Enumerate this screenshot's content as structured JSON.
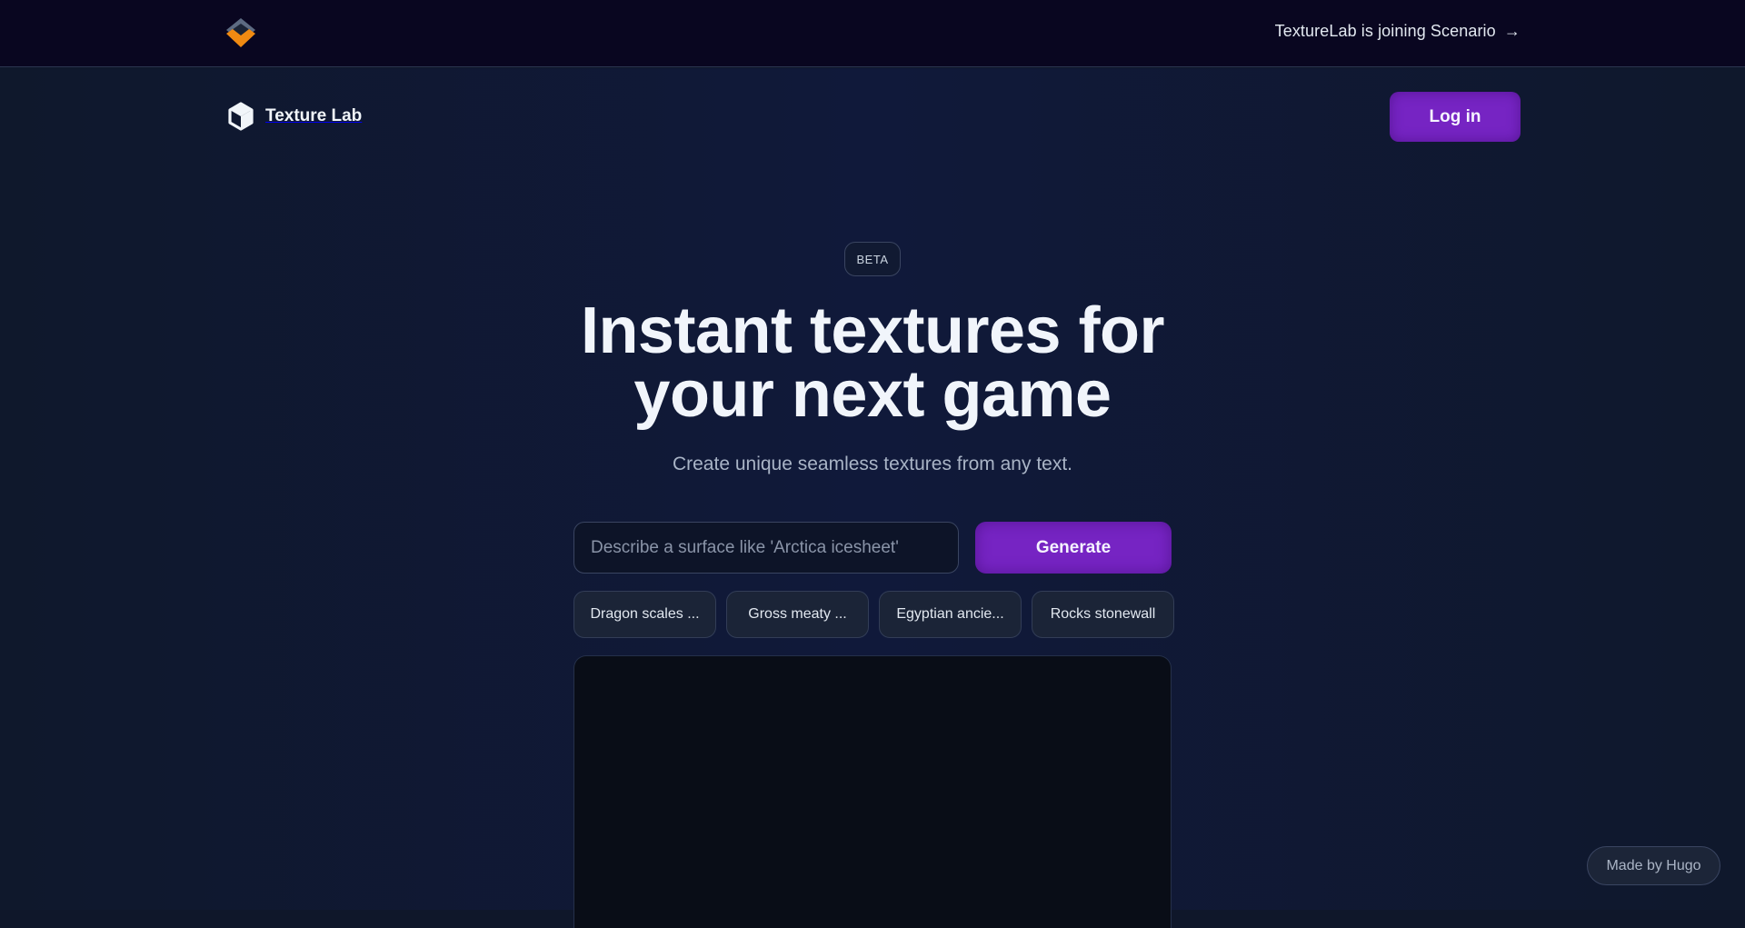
{
  "topbar": {
    "logo_icon": "scenario-layers-logo-icon",
    "announcement": "TextureLab is joining Scenario",
    "announcement_arrow": "→"
  },
  "nav": {
    "brand_icon": "cube-icon",
    "brand_name": "Texture Lab",
    "login_label": "Log in"
  },
  "hero": {
    "badge": "BETA",
    "headline_line1": "Instant textures for",
    "headline_line2": "your next game",
    "subtitle": "Create unique seamless textures from any text."
  },
  "prompt": {
    "placeholder": "Describe a surface like 'Arctica icesheet'",
    "value": "",
    "generate_label": "Generate"
  },
  "suggestions": [
    {
      "label": "Dragon scales ..."
    },
    {
      "label": "Gross meaty ..."
    },
    {
      "label": "Egyptian ancie..."
    },
    {
      "label": "Rocks stonewall"
    }
  ],
  "footer": {
    "made_by": "Made by Hugo"
  },
  "colors": {
    "accent": "#7624c3",
    "topbar_bg": "#090620",
    "page_bg": "#10193a",
    "logo_orange": "#f08a12",
    "logo_slate": "#5d6b82"
  }
}
